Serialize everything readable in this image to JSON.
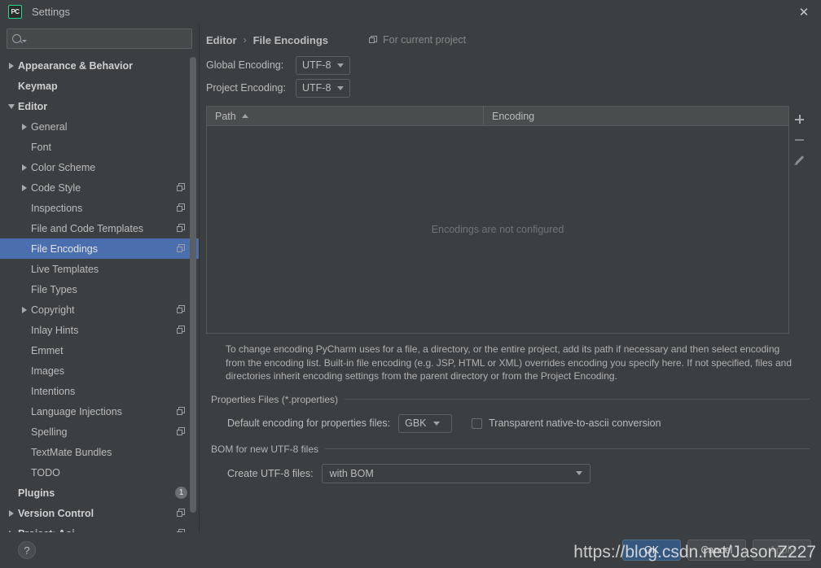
{
  "window": {
    "title": "Settings",
    "logo_text": "PC",
    "close_icon": "close-icon"
  },
  "sidebar": {
    "search": {
      "value": "",
      "placeholder": ""
    },
    "items": [
      {
        "label": "Appearance & Behavior",
        "indent": 0,
        "arrow": "right",
        "bold": true,
        "project_icon": false,
        "badge": null,
        "selected": false
      },
      {
        "label": "Keymap",
        "indent": 0,
        "arrow": "none",
        "bold": true,
        "project_icon": false,
        "badge": null,
        "selected": false
      },
      {
        "label": "Editor",
        "indent": 0,
        "arrow": "down",
        "bold": true,
        "project_icon": false,
        "badge": null,
        "selected": false
      },
      {
        "label": "General",
        "indent": 1,
        "arrow": "right",
        "bold": false,
        "project_icon": false,
        "badge": null,
        "selected": false
      },
      {
        "label": "Font",
        "indent": 1,
        "arrow": "none",
        "bold": false,
        "project_icon": false,
        "badge": null,
        "selected": false
      },
      {
        "label": "Color Scheme",
        "indent": 1,
        "arrow": "right",
        "bold": false,
        "project_icon": false,
        "badge": null,
        "selected": false
      },
      {
        "label": "Code Style",
        "indent": 1,
        "arrow": "right",
        "bold": false,
        "project_icon": true,
        "badge": null,
        "selected": false
      },
      {
        "label": "Inspections",
        "indent": 1,
        "arrow": "none",
        "bold": false,
        "project_icon": true,
        "badge": null,
        "selected": false
      },
      {
        "label": "File and Code Templates",
        "indent": 1,
        "arrow": "none",
        "bold": false,
        "project_icon": true,
        "badge": null,
        "selected": false
      },
      {
        "label": "File Encodings",
        "indent": 1,
        "arrow": "none",
        "bold": false,
        "project_icon": true,
        "badge": null,
        "selected": true
      },
      {
        "label": "Live Templates",
        "indent": 1,
        "arrow": "none",
        "bold": false,
        "project_icon": false,
        "badge": null,
        "selected": false
      },
      {
        "label": "File Types",
        "indent": 1,
        "arrow": "none",
        "bold": false,
        "project_icon": false,
        "badge": null,
        "selected": false
      },
      {
        "label": "Copyright",
        "indent": 1,
        "arrow": "right",
        "bold": false,
        "project_icon": true,
        "badge": null,
        "selected": false
      },
      {
        "label": "Inlay Hints",
        "indent": 1,
        "arrow": "none",
        "bold": false,
        "project_icon": true,
        "badge": null,
        "selected": false
      },
      {
        "label": "Emmet",
        "indent": 1,
        "arrow": "none",
        "bold": false,
        "project_icon": false,
        "badge": null,
        "selected": false
      },
      {
        "label": "Images",
        "indent": 1,
        "arrow": "none",
        "bold": false,
        "project_icon": false,
        "badge": null,
        "selected": false
      },
      {
        "label": "Intentions",
        "indent": 1,
        "arrow": "none",
        "bold": false,
        "project_icon": false,
        "badge": null,
        "selected": false
      },
      {
        "label": "Language Injections",
        "indent": 1,
        "arrow": "none",
        "bold": false,
        "project_icon": true,
        "badge": null,
        "selected": false
      },
      {
        "label": "Spelling",
        "indent": 1,
        "arrow": "none",
        "bold": false,
        "project_icon": true,
        "badge": null,
        "selected": false
      },
      {
        "label": "TextMate Bundles",
        "indent": 1,
        "arrow": "none",
        "bold": false,
        "project_icon": false,
        "badge": null,
        "selected": false
      },
      {
        "label": "TODO",
        "indent": 1,
        "arrow": "none",
        "bold": false,
        "project_icon": false,
        "badge": null,
        "selected": false
      },
      {
        "label": "Plugins",
        "indent": 0,
        "arrow": "none",
        "bold": true,
        "project_icon": false,
        "badge": "1",
        "selected": false
      },
      {
        "label": "Version Control",
        "indent": 0,
        "arrow": "right",
        "bold": true,
        "project_icon": true,
        "badge": null,
        "selected": false
      },
      {
        "label": "Project: Aoi",
        "indent": 0,
        "arrow": "right",
        "bold": true,
        "project_icon": true,
        "badge": null,
        "selected": false
      }
    ]
  },
  "main": {
    "breadcrumb": {
      "parent": "Editor",
      "separator": "›",
      "current": "File Encodings"
    },
    "for_current_project": "For current project",
    "global_encoding": {
      "label": "Global Encoding:",
      "value": "UTF-8"
    },
    "project_encoding": {
      "label": "Project Encoding:",
      "value": "UTF-8"
    },
    "table": {
      "columns": [
        "Path",
        "Encoding"
      ],
      "sort_column": "Path",
      "sort_direction": "ascending",
      "rows": [],
      "empty_message": "Encodings are not configured",
      "toolbar": {
        "add": "add-icon",
        "remove": "remove-icon",
        "edit": "edit-icon"
      }
    },
    "help_text": "To change encoding PyCharm uses for a file, a directory, or the entire project, add its path if necessary and then select encoding from the encoding list. Built-in file encoding (e.g. JSP, HTML or XML) overrides encoding you specify here. If not specified, files and directories inherit encoding settings from the parent directory or from the Project Encoding.",
    "properties_group": {
      "title": "Properties Files (*.properties)",
      "default_encoding_label": "Default encoding for properties files:",
      "default_encoding_value": "GBK",
      "transparent_label": "Transparent native-to-ascii conversion",
      "transparent_checked": false
    },
    "bom_group": {
      "title": "BOM for new UTF-8 files",
      "create_label": "Create UTF-8 files:",
      "create_value": "with BOM"
    }
  },
  "footer": {
    "help": "?",
    "ok": "OK",
    "cancel": "Cancel",
    "apply": "Apply"
  },
  "watermark": "https://blog.csdn.net/JasonZ227",
  "colors": {
    "background": "#3c3f41",
    "selection": "#4b6eaf",
    "primary_button": "#365880",
    "accent_logo": "#21d789",
    "text": "#bbbbbb"
  }
}
